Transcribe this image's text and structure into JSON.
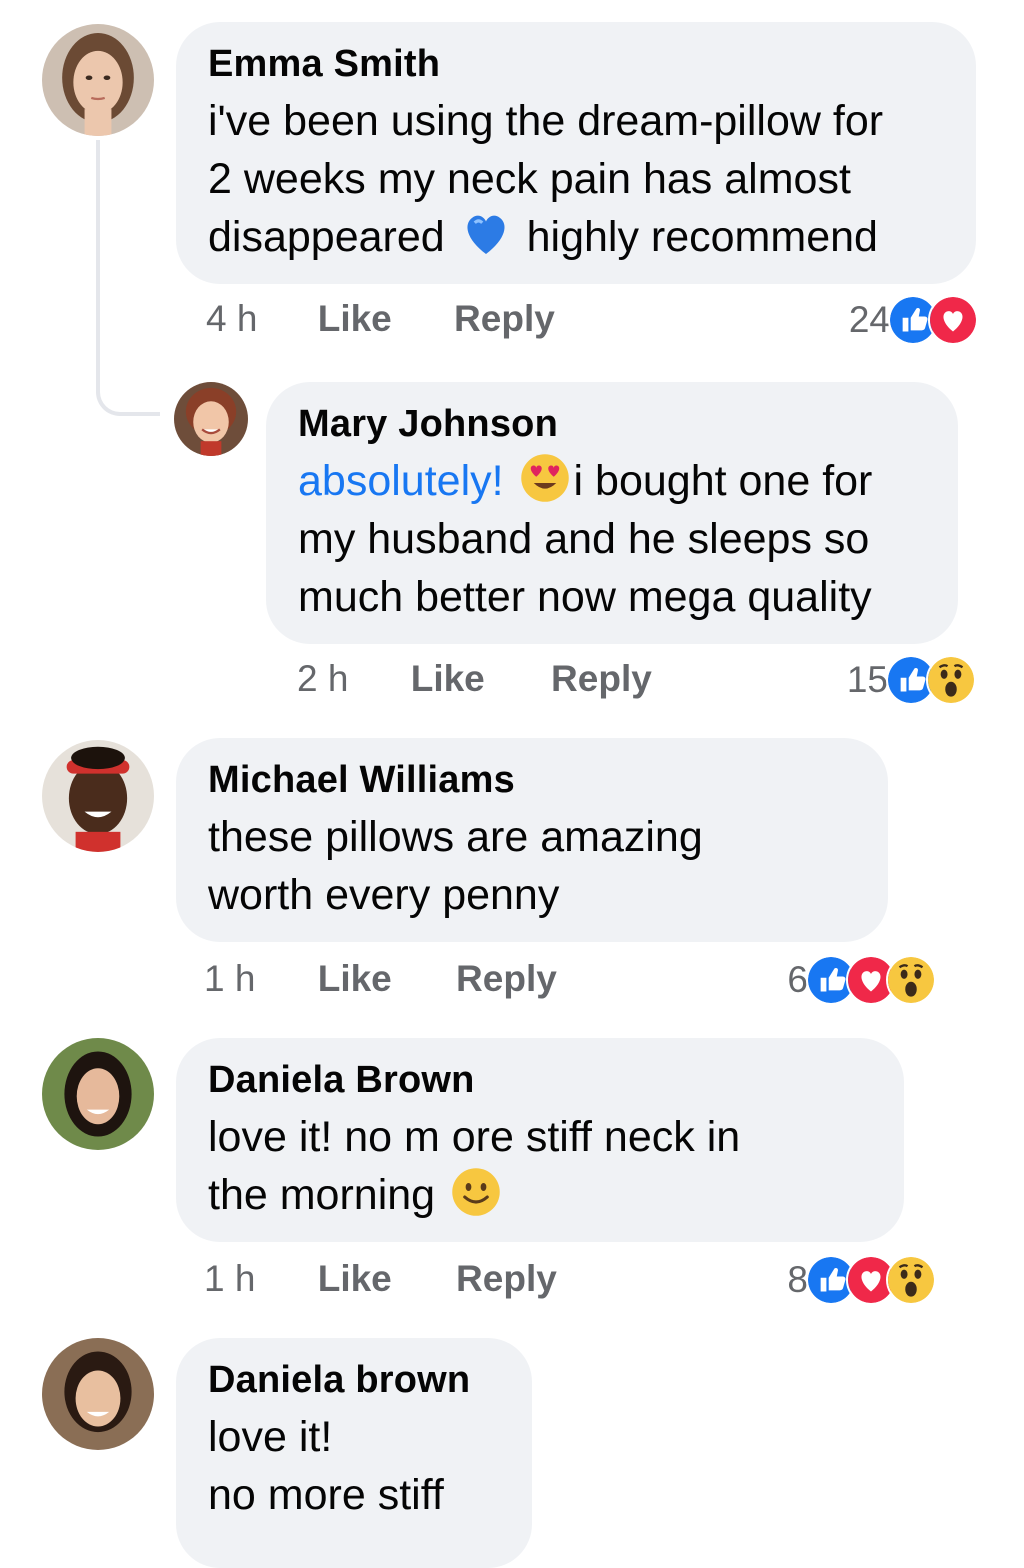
{
  "comments": [
    {
      "author": "Emma Smith",
      "lines": [
        "i've been using the dream-pillow for",
        "2 weeks my neck pain has almost"
      ],
      "line3_before": "disappeared",
      "line3_after": "highly recommend",
      "time": "4 h",
      "like": "Like",
      "reply": "Reply",
      "reaction_count": "24",
      "reactions": [
        "like-icon",
        "love-icon"
      ]
    },
    {
      "author": "Mary Johnson",
      "mention": "absolutely!",
      "line1_after": "i bought one for",
      "lines": [
        "my husband and he sleeps so",
        "much better now mega quality"
      ],
      "time": "2 h",
      "like": "Like",
      "reply": "Reply",
      "reaction_count": "15",
      "reactions": [
        "like-icon",
        "wow-icon"
      ]
    },
    {
      "author": "Michael Williams",
      "lines": [
        "these pillows are amazing",
        "worth every penny"
      ],
      "time": "1 h",
      "like": "Like",
      "reply": "Reply",
      "reaction_count": "6",
      "reactions": [
        "like-icon",
        "love-icon",
        "wow-icon"
      ]
    },
    {
      "author": "Daniela Brown",
      "lines": [
        "love it! no m ore stiff neck in"
      ],
      "line2_before": "the morning",
      "time": "1 h",
      "like": "Like",
      "reply": "Reply",
      "reaction_count": "8",
      "reactions": [
        "like-icon",
        "love-icon",
        "wow-icon"
      ]
    },
    {
      "author": "Daniela brown",
      "lines": [
        "love it!",
        "no more stiff"
      ]
    }
  ],
  "colors": {
    "bubble": "#f0f2f5",
    "mention": "#1877f2",
    "like": "#1877f2",
    "love": "#f02849",
    "meta": "#65676b"
  }
}
